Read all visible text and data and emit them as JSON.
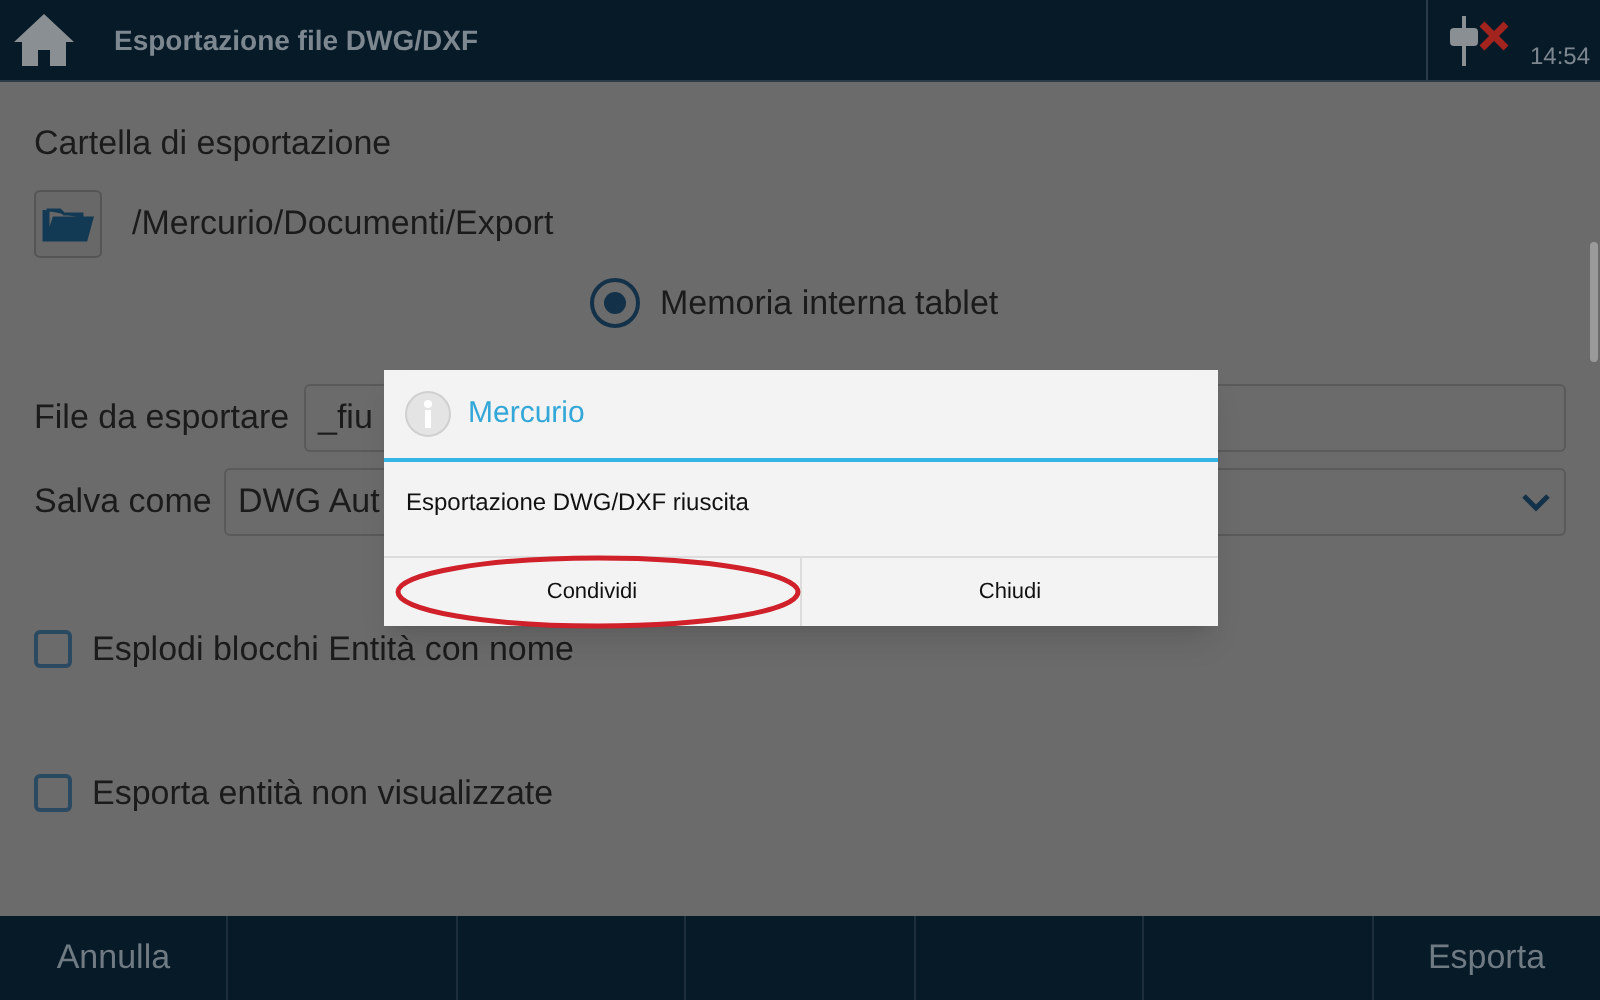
{
  "header": {
    "title": "Esportazione file DWG/DXF",
    "time": "14:54"
  },
  "folder": {
    "label": "Cartella di esportazione",
    "path": "/Mercurio/Documenti/Export"
  },
  "storage": {
    "label": "Memoria interna tablet",
    "selected": true
  },
  "file_field": {
    "label": "File da esportare",
    "value": "_fiu"
  },
  "save_as": {
    "label": "Salva come",
    "value": "DWG Aut"
  },
  "options": [
    {
      "label": "Esplodi blocchi Entità con nome",
      "checked": false
    },
    {
      "label": "Esporta entità non visualizzate",
      "checked": false
    }
  ],
  "dialog": {
    "title": "Mercurio",
    "message": "Esportazione DWG/DXF riuscita",
    "buttons": [
      {
        "label": "Condividi",
        "highlighted": true
      },
      {
        "label": "Chiudi",
        "highlighted": false
      }
    ]
  },
  "footer": {
    "buttons": [
      "Annulla",
      "Esporta"
    ]
  }
}
